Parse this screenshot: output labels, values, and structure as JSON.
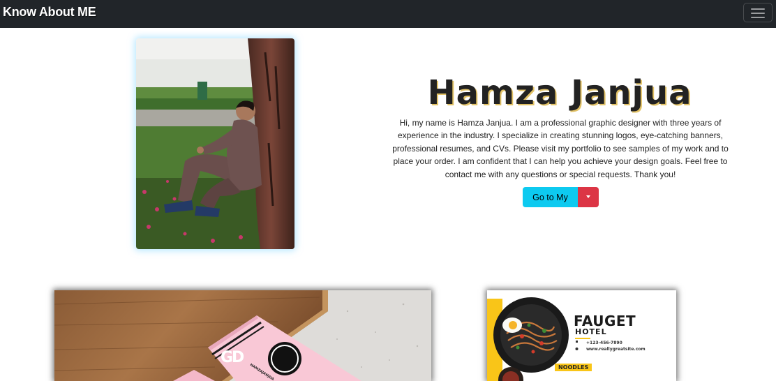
{
  "navbar": {
    "brand": "Know About ME",
    "toggler_icon": "hamburger-menu-icon"
  },
  "hero": {
    "title": "Hamza Janjua",
    "bio": "Hi, my name is Hamza Janjua. I am a professional graphic designer with three years of experience in the industry. I specialize in creating stunning logos, eye-catching banners, professional resumes, and CVs. Please visit my portfolio to see samples of my work and to place your order. I am confident that I can help you achieve your design goals. Feel free to contact me with any questions or special requests. Thank you!",
    "button_label": "Go to My",
    "button_color": "#0dcaf0",
    "dropdown_color": "#dc3545",
    "dropdown_icon": "caret-down-icon"
  },
  "portfolio": {
    "card1": {
      "logo_text": "GD",
      "small_text": "HAMZAJANJUA"
    },
    "card2": {
      "title": "FAUGET",
      "subtitle": "HOTEL",
      "phone": "+123-456-7890",
      "website": "www.reallygreatsite.com",
      "badge": "NOODLES",
      "accent_color": "#f9c518"
    }
  }
}
